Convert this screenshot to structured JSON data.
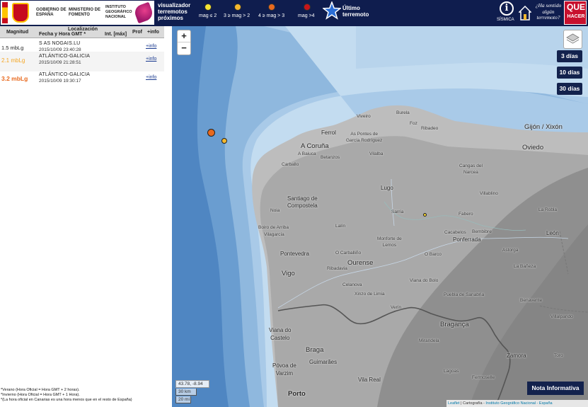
{
  "header": {
    "gov_line1": "GOBIERNO DE ESPAÑA",
    "gov_line2": "MINISTERIO DE FOMENTO",
    "gov_line3": "INSTITUTO GEOGRÁFICO NACIONAL",
    "viz_title": "visualizador\nterremotos\npróximos",
    "legend": [
      {
        "label": "mag ≤ 2",
        "color": "#f4e434"
      },
      {
        "label": "3 ≥ mag > 2",
        "color": "#f5b82e"
      },
      {
        "label": "4 ≥ mag > 3",
        "color": "#e8691e"
      },
      {
        "label": "mag >4",
        "color": "#c8141a"
      }
    ],
    "last_quake": "Último\nterremoto",
    "sismica": "SÍSMICA",
    "felt": "¿Ha sentido\nalgún\nterremoto?",
    "que_line1": "QUE",
    "que_line2": "HACER"
  },
  "table": {
    "col_mag": "Magnitud",
    "col_loc": "Localización",
    "col_date": "Fecha y Hora GMT *",
    "col_int": "Int. [máx]",
    "col_prof": "Prof",
    "col_info": "+info",
    "rows": [
      {
        "mag": "1.5 mbLg",
        "loc": "S AS NOGAIS.LU",
        "dt": "2015/10/09 23:40:28",
        "info": "+info",
        "color": "#222222"
      },
      {
        "mag": "2.1 mbLg",
        "loc": "ATLÁNTICO-GALICIA",
        "dt": "2015/10/09 21:28:51",
        "info": "+info",
        "color": "#f5a623"
      },
      {
        "mag": "3.2 mbLg",
        "loc": "ATLÁNTICO-GALICIA",
        "dt": "2015/10/09 19:30:17",
        "info": "+info",
        "color": "#e8691e"
      }
    ]
  },
  "notes": [
    "*Verano (Hora Oficial = Hora GMT + 2 horas).",
    "*Invierno (Hora Oficial = Hora GMT + 1 Hora).",
    "*(La hora oficial en Canarias es una hora menos que en el resto de España)"
  ],
  "map": {
    "zoom_in": "+",
    "zoom_out": "−",
    "days": [
      "3 días",
      "10 días",
      "30 días"
    ],
    "nota": "Nota Informativa",
    "coords": "43.78, -8.94",
    "scale_km": "30 km",
    "scale_mi": "20 mi",
    "attribution_a": "Leaflet",
    "attribution_b": " | Cartografía - ",
    "attribution_c": "Instituto Geográfico Nacional - España",
    "places": {
      "viveiro": "Viveiro",
      "burela": "Burela",
      "foz": "Foz",
      "ribadeo": "Ribadeo",
      "gijon": "Gijón / Xixón",
      "ferrol": "Ferrol",
      "pontes": "As Pontes de\nGarcía Rodríguez",
      "coruna": "A Coruña",
      "baiuca": "A Baiuca",
      "betanzos": "Betanzos",
      "vilalba": "Vilalba",
      "oviedo": "Oviedo",
      "carballo": "Carballo",
      "cangas": "Cangas del\nNarcea",
      "lugo": "Lugo",
      "santiago": "Santiago de\nCompostela",
      "villablino": "Villablino",
      "noia": "Noia",
      "sarria": "Sarria",
      "fabero": "Fabero",
      "larobla": "La Robla",
      "boiro": "Boiro de Arriba",
      "lalin": "Lalín",
      "monforte": "Monforte de\nLemos",
      "cacabelos": "Cacabelos",
      "bembibre": "Bembibre",
      "ponferrada": "Ponferrada",
      "leon": "León",
      "vilagarcia": "Vilagarcía",
      "pontevedra": "Pontevedra",
      "ocarballino": "O Carballiño",
      "obarco": "O Barco",
      "astorga": "Astorga",
      "ourense": "Ourense",
      "vigo": "Vigo",
      "ribadavia": "Ribadavia",
      "labaneza": "La Bañeza",
      "vianabolo": "Viana do Bolo",
      "celanova": "Celanova",
      "xinzo": "Xinzo de Limia",
      "puebla": "Puebla de Sanabria",
      "benavente": "Benavente",
      "verin": "Verín",
      "viana": "Viana do\nCastelo",
      "braganca": "Bragança",
      "braga": "Braga",
      "guimaraes": "Guimarães",
      "zamora": "Zamora",
      "povoa": "Póvoa de\nVarzim",
      "vilareal": "Vila Real",
      "porto": "Porto",
      "villalpando": "Villalpando",
      "toro": "Toro",
      "mirandela": "Mirandela",
      "lagoas": "Lagoas",
      "fermoselle": "Fermoselle"
    },
    "quake_colors": {
      "small": "#f2d22e",
      "medium": "#f5b82e",
      "large": "#e8691e"
    }
  }
}
